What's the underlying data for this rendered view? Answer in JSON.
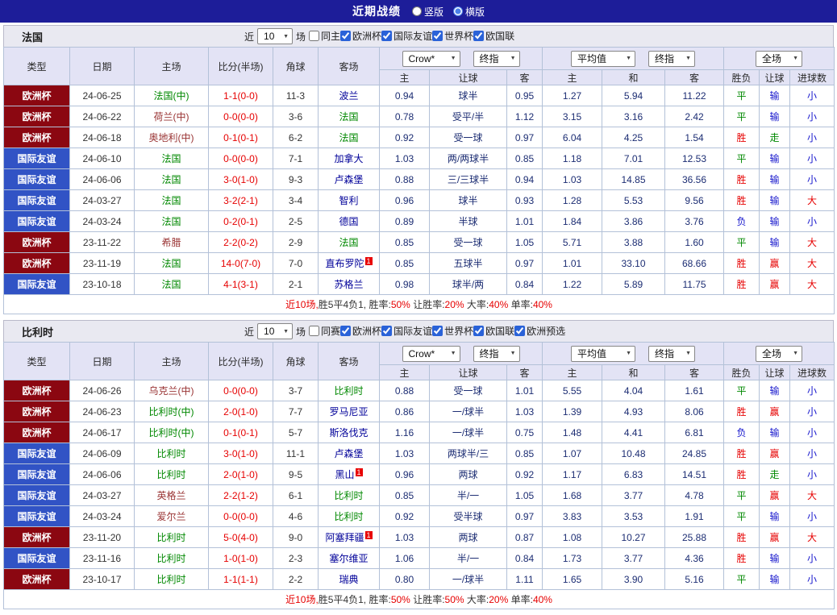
{
  "top_bar": {
    "title": "近期战绩",
    "radios": [
      {
        "label": "竖版",
        "checked": false
      },
      {
        "label": "横版",
        "checked": true
      }
    ]
  },
  "table_header": {
    "type": "类型",
    "date": "日期",
    "home": "主场",
    "score": "比分(半场)",
    "corners": "角球",
    "away": "客场",
    "odds_selects": [
      "Crow*",
      "终指"
    ],
    "avg_selects": [
      "平均值",
      "终指"
    ],
    "scope_select": "全场",
    "odds_sub": [
      "主",
      "让球",
      "客"
    ],
    "avg_sub": [
      "主",
      "和",
      "客"
    ],
    "result_sub": [
      "胜负",
      "让球",
      "进球数"
    ]
  },
  "palette": {
    "topbar_bg": "#1d1d99",
    "header_bg": "#e3e3f5",
    "score_color": "#e60000",
    "type_colors": {
      "欧洲杯": "#8b0711",
      "国际友谊": "#3153c5"
    },
    "role_colors": {
      "focus": "#008800",
      "home": "#993333",
      "away": "#000099"
    },
    "result_colors": {
      "胜": "#e60000",
      "平": "#008800",
      "负": "#1515cc",
      "赢": "#e60000",
      "输": "#1515cc",
      "走": "#008800",
      "大": "#e60000",
      "小": "#1515cc"
    }
  },
  "sections": [
    {
      "team": "法国",
      "filter": {
        "near_label": "近",
        "games_count": "10",
        "games_label": "场",
        "checkboxes": [
          {
            "label": "同主",
            "checked": false
          },
          {
            "label": "欧洲杯",
            "checked": true
          },
          {
            "label": "国际友谊",
            "checked": true
          },
          {
            "label": "世界杯",
            "checked": true
          },
          {
            "label": "欧国联",
            "checked": true
          }
        ]
      },
      "rows": [
        {
          "type": "欧洲杯",
          "date": "24-06-25",
          "home": "法国(中)",
          "home_role": "focus",
          "home_badge": "",
          "score": "1-1(0-0)",
          "corners": "11-3",
          "away": "波兰",
          "away_role": "away",
          "away_badge": "",
          "odds": [
            "0.94",
            "球半",
            "0.95"
          ],
          "avg": [
            "1.27",
            "5.94",
            "11.22"
          ],
          "results": [
            "平",
            "输",
            "小"
          ]
        },
        {
          "type": "欧洲杯",
          "date": "24-06-22",
          "home": "荷兰(中)",
          "home_role": "home",
          "home_badge": "",
          "score": "0-0(0-0)",
          "corners": "3-6",
          "away": "法国",
          "away_role": "focus",
          "away_badge": "",
          "odds": [
            "0.78",
            "受平/半",
            "1.12"
          ],
          "avg": [
            "3.15",
            "3.16",
            "2.42"
          ],
          "results": [
            "平",
            "输",
            "小"
          ]
        },
        {
          "type": "欧洲杯",
          "date": "24-06-18",
          "home": "奥地利(中)",
          "home_role": "home",
          "home_badge": "",
          "score": "0-1(0-1)",
          "corners": "6-2",
          "away": "法国",
          "away_role": "focus",
          "away_badge": "",
          "odds": [
            "0.92",
            "受一球",
            "0.97"
          ],
          "avg": [
            "6.04",
            "4.25",
            "1.54"
          ],
          "results": [
            "胜",
            "走",
            "小"
          ]
        },
        {
          "type": "国际友谊",
          "date": "24-06-10",
          "home": "法国",
          "home_role": "focus",
          "home_badge": "",
          "score": "0-0(0-0)",
          "corners": "7-1",
          "away": "加拿大",
          "away_role": "away",
          "away_badge": "",
          "odds": [
            "1.03",
            "两/两球半",
            "0.85"
          ],
          "avg": [
            "1.18",
            "7.01",
            "12.53"
          ],
          "results": [
            "平",
            "输",
            "小"
          ]
        },
        {
          "type": "国际友谊",
          "date": "24-06-06",
          "home": "法国",
          "home_role": "focus",
          "home_badge": "",
          "score": "3-0(1-0)",
          "corners": "9-3",
          "away": "卢森堡",
          "away_role": "away",
          "away_badge": "",
          "odds": [
            "0.88",
            "三/三球半",
            "0.94"
          ],
          "avg": [
            "1.03",
            "14.85",
            "36.56"
          ],
          "results": [
            "胜",
            "输",
            "小"
          ]
        },
        {
          "type": "国际友谊",
          "date": "24-03-27",
          "home": "法国",
          "home_role": "focus",
          "home_badge": "",
          "score": "3-2(2-1)",
          "corners": "3-4",
          "away": "智利",
          "away_role": "away",
          "away_badge": "",
          "odds": [
            "0.96",
            "球半",
            "0.93"
          ],
          "avg": [
            "1.28",
            "5.53",
            "9.56"
          ],
          "results": [
            "胜",
            "输",
            "大"
          ]
        },
        {
          "type": "国际友谊",
          "date": "24-03-24",
          "home": "法国",
          "home_role": "focus",
          "home_badge": "",
          "score": "0-2(0-1)",
          "corners": "2-5",
          "away": "德国",
          "away_role": "away",
          "away_badge": "",
          "odds": [
            "0.89",
            "半球",
            "1.01"
          ],
          "avg": [
            "1.84",
            "3.86",
            "3.76"
          ],
          "results": [
            "负",
            "输",
            "小"
          ]
        },
        {
          "type": "欧洲杯",
          "date": "23-11-22",
          "home": "希腊",
          "home_role": "home",
          "home_badge": "",
          "score": "2-2(0-2)",
          "corners": "2-9",
          "away": "法国",
          "away_role": "focus",
          "away_badge": "",
          "odds": [
            "0.85",
            "受一球",
            "1.05"
          ],
          "avg": [
            "5.71",
            "3.88",
            "1.60"
          ],
          "results": [
            "平",
            "输",
            "大"
          ]
        },
        {
          "type": "欧洲杯",
          "date": "23-11-19",
          "home": "法国",
          "home_role": "focus",
          "home_badge": "",
          "score": "14-0(7-0)",
          "corners": "7-0",
          "away": "直布罗陀",
          "away_role": "away",
          "away_badge": "1",
          "odds": [
            "0.85",
            "五球半",
            "0.97"
          ],
          "avg": [
            "1.01",
            "33.10",
            "68.66"
          ],
          "results": [
            "胜",
            "赢",
            "大"
          ]
        },
        {
          "type": "国际友谊",
          "date": "23-10-18",
          "home": "法国",
          "home_role": "focus",
          "home_badge": "",
          "score": "4-1(3-1)",
          "corners": "2-1",
          "away": "苏格兰",
          "away_role": "away",
          "away_badge": "",
          "odds": [
            "0.98",
            "球半/两",
            "0.84"
          ],
          "avg": [
            "1.22",
            "5.89",
            "11.75"
          ],
          "results": [
            "胜",
            "赢",
            "大"
          ]
        }
      ],
      "summary": [
        {
          "text": "近10场,",
          "color": "#e60000"
        },
        {
          "text": "胜5平4负1, ",
          "color": "#333333"
        },
        {
          "text": "胜率:",
          "color": "#333333"
        },
        {
          "text": "50%",
          "color": "#e60000"
        },
        {
          "text": " 让胜率:",
          "color": "#333333"
        },
        {
          "text": "20%",
          "color": "#e60000"
        },
        {
          "text": " 大率:",
          "color": "#333333"
        },
        {
          "text": "40%",
          "color": "#e60000"
        },
        {
          "text": " 单率:",
          "color": "#333333"
        },
        {
          "text": "40%",
          "color": "#e60000"
        }
      ]
    },
    {
      "team": "比利时",
      "filter": {
        "near_label": "近",
        "games_count": "10",
        "games_label": "场",
        "checkboxes": [
          {
            "label": "同赛",
            "checked": false
          },
          {
            "label": "欧洲杯",
            "checked": true
          },
          {
            "label": "国际友谊",
            "checked": true
          },
          {
            "label": "世界杯",
            "checked": true
          },
          {
            "label": "欧国联",
            "checked": true
          },
          {
            "label": "欧洲预选",
            "checked": true
          }
        ]
      },
      "rows": [
        {
          "type": "欧洲杯",
          "date": "24-06-26",
          "home": "乌克兰(中)",
          "home_role": "home",
          "home_badge": "",
          "score": "0-0(0-0)",
          "corners": "3-7",
          "away": "比利时",
          "away_role": "focus",
          "away_badge": "",
          "odds": [
            "0.88",
            "受一球",
            "1.01"
          ],
          "avg": [
            "5.55",
            "4.04",
            "1.61"
          ],
          "results": [
            "平",
            "输",
            "小"
          ]
        },
        {
          "type": "欧洲杯",
          "date": "24-06-23",
          "home": "比利时(中)",
          "home_role": "focus",
          "home_badge": "",
          "score": "2-0(1-0)",
          "corners": "7-7",
          "away": "罗马尼亚",
          "away_role": "away",
          "away_badge": "",
          "odds": [
            "0.86",
            "一/球半",
            "1.03"
          ],
          "avg": [
            "1.39",
            "4.93",
            "8.06"
          ],
          "results": [
            "胜",
            "赢",
            "小"
          ]
        },
        {
          "type": "欧洲杯",
          "date": "24-06-17",
          "home": "比利时(中)",
          "home_role": "focus",
          "home_badge": "",
          "score": "0-1(0-1)",
          "corners": "5-7",
          "away": "斯洛伐克",
          "away_role": "away",
          "away_badge": "",
          "odds": [
            "1.16",
            "一/球半",
            "0.75"
          ],
          "avg": [
            "1.48",
            "4.41",
            "6.81"
          ],
          "results": [
            "负",
            "输",
            "小"
          ]
        },
        {
          "type": "国际友谊",
          "date": "24-06-09",
          "home": "比利时",
          "home_role": "focus",
          "home_badge": "",
          "score": "3-0(1-0)",
          "corners": "11-1",
          "away": "卢森堡",
          "away_role": "away",
          "away_badge": "",
          "odds": [
            "1.03",
            "两球半/三",
            "0.85"
          ],
          "avg": [
            "1.07",
            "10.48",
            "24.85"
          ],
          "results": [
            "胜",
            "赢",
            "小"
          ]
        },
        {
          "type": "国际友谊",
          "date": "24-06-06",
          "home": "比利时",
          "home_role": "focus",
          "home_badge": "",
          "score": "2-0(1-0)",
          "corners": "9-5",
          "away": "黑山",
          "away_role": "away",
          "away_badge": "1",
          "odds": [
            "0.96",
            "两球",
            "0.92"
          ],
          "avg": [
            "1.17",
            "6.83",
            "14.51"
          ],
          "results": [
            "胜",
            "走",
            "小"
          ]
        },
        {
          "type": "国际友谊",
          "date": "24-03-27",
          "home": "英格兰",
          "home_role": "home",
          "home_badge": "",
          "score": "2-2(1-2)",
          "corners": "6-1",
          "away": "比利时",
          "away_role": "focus",
          "away_badge": "",
          "odds": [
            "0.85",
            "半/一",
            "1.05"
          ],
          "avg": [
            "1.68",
            "3.77",
            "4.78"
          ],
          "results": [
            "平",
            "赢",
            "大"
          ]
        },
        {
          "type": "国际友谊",
          "date": "24-03-24",
          "home": "爱尔兰",
          "home_role": "home",
          "home_badge": "",
          "score": "0-0(0-0)",
          "corners": "4-6",
          "away": "比利时",
          "away_role": "focus",
          "away_badge": "",
          "odds": [
            "0.92",
            "受半球",
            "0.97"
          ],
          "avg": [
            "3.83",
            "3.53",
            "1.91"
          ],
          "results": [
            "平",
            "输",
            "小"
          ]
        },
        {
          "type": "欧洲杯",
          "date": "23-11-20",
          "home": "比利时",
          "home_role": "focus",
          "home_badge": "",
          "score": "5-0(4-0)",
          "corners": "9-0",
          "away": "阿塞拜疆",
          "away_role": "away",
          "away_badge": "1",
          "odds": [
            "1.03",
            "两球",
            "0.87"
          ],
          "avg": [
            "1.08",
            "10.27",
            "25.88"
          ],
          "results": [
            "胜",
            "赢",
            "大"
          ]
        },
        {
          "type": "国际友谊",
          "date": "23-11-16",
          "home": "比利时",
          "home_role": "focus",
          "home_badge": "",
          "score": "1-0(1-0)",
          "corners": "2-3",
          "away": "塞尔维亚",
          "away_role": "away",
          "away_badge": "",
          "odds": [
            "1.06",
            "半/一",
            "0.84"
          ],
          "avg": [
            "1.73",
            "3.77",
            "4.36"
          ],
          "results": [
            "胜",
            "输",
            "小"
          ]
        },
        {
          "type": "欧洲杯",
          "date": "23-10-17",
          "home": "比利时",
          "home_role": "focus",
          "home_badge": "",
          "score": "1-1(1-1)",
          "corners": "2-2",
          "away": "瑞典",
          "away_role": "away",
          "away_badge": "",
          "odds": [
            "0.80",
            "一/球半",
            "1.11"
          ],
          "avg": [
            "1.65",
            "3.90",
            "5.16"
          ],
          "results": [
            "平",
            "输",
            "小"
          ]
        }
      ],
      "summary": [
        {
          "text": "近10场,",
          "color": "#e60000"
        },
        {
          "text": "胜5平4负1, ",
          "color": "#333333"
        },
        {
          "text": "胜率:",
          "color": "#333333"
        },
        {
          "text": "50%",
          "color": "#e60000"
        },
        {
          "text": " 让胜率:",
          "color": "#333333"
        },
        {
          "text": "50%",
          "color": "#e60000"
        },
        {
          "text": " 大率:",
          "color": "#333333"
        },
        {
          "text": "20%",
          "color": "#e60000"
        },
        {
          "text": " 单率:",
          "color": "#333333"
        },
        {
          "text": "40%",
          "color": "#e60000"
        }
      ]
    }
  ]
}
